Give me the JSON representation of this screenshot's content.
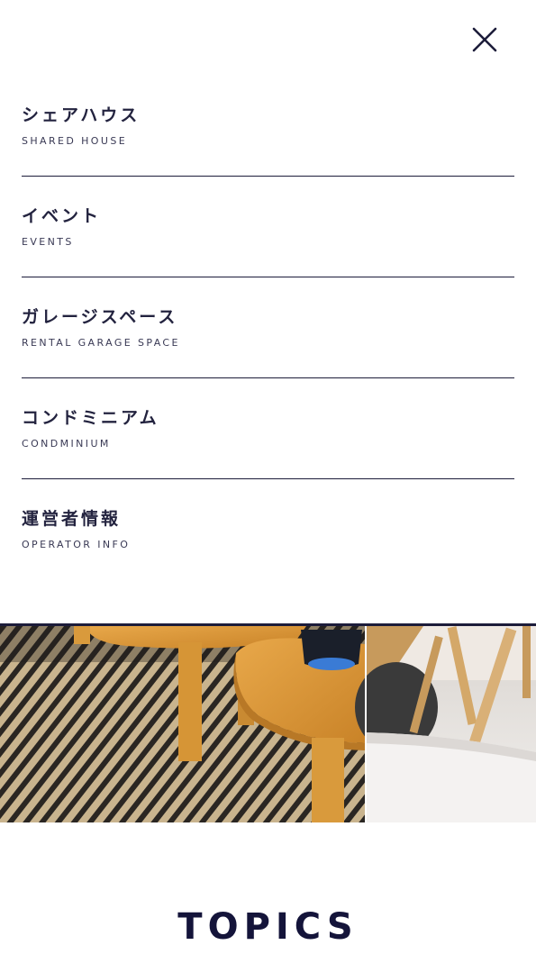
{
  "close": {
    "icon": "close-icon"
  },
  "menu": {
    "items": [
      {
        "jp": "シェアハウス",
        "en": "SHARED HOUSE"
      },
      {
        "jp": "イベント",
        "en": "EVENTS"
      },
      {
        "jp": "ガレージスペース",
        "en": "RENTAL GARAGE SPACE"
      },
      {
        "jp": "コンドミニアム",
        "en": "CONDMINIUM"
      },
      {
        "jp": "運営者情報",
        "en": "OPERATOR INFO"
      }
    ]
  },
  "banner": {
    "image": "interior-furniture-photo"
  },
  "section": {
    "title": "TOPICS"
  },
  "colors": {
    "text": "#1c1c3a",
    "background": "#ffffff",
    "divider": "#1c1c3a"
  }
}
